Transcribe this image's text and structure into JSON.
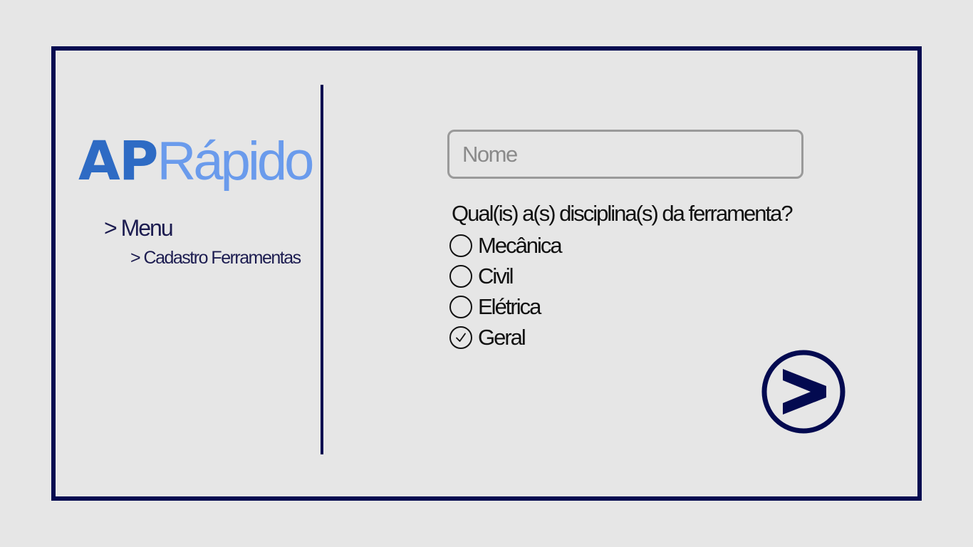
{
  "logo": {
    "part1": "AP",
    "part2": "Rápido"
  },
  "nav": {
    "menu_label": "> Menu",
    "submenu_label": "> Cadastro Ferramentas"
  },
  "form": {
    "name_placeholder": "Nome",
    "name_value": "",
    "question": "Qual(is) a(s) disciplina(s) da ferramenta?",
    "options": [
      {
        "label": "Mecânica",
        "checked": false
      },
      {
        "label": "Civil",
        "checked": false
      },
      {
        "label": "Elétrica",
        "checked": false
      },
      {
        "label": "Geral",
        "checked": true
      }
    ]
  },
  "colors": {
    "frame": "#030a50",
    "logo_ap": "#2e6bc4",
    "logo_rapido": "#6a9bec",
    "nav_text": "#1c1c50",
    "background": "#e6e6e6"
  },
  "icons": {
    "next": "chevron-right-circle-icon",
    "checked": "check-icon"
  }
}
